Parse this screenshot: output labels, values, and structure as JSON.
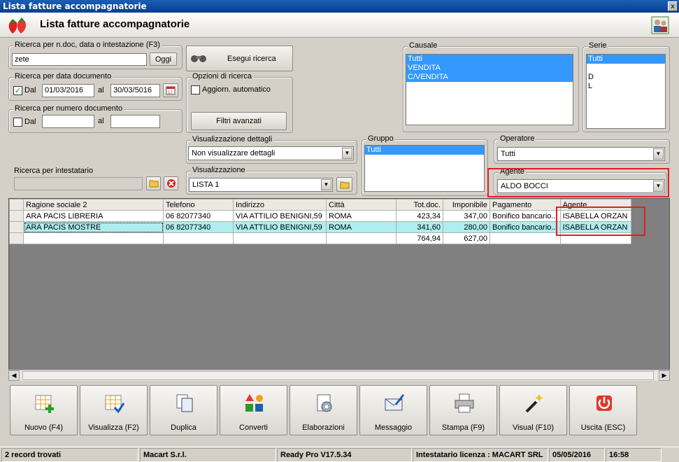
{
  "window": {
    "title": "Lista fatture accompagnatorie",
    "close_glyph": "x"
  },
  "header": {
    "title": "Lista fatture accompagnatorie"
  },
  "search_main": {
    "legend": "Ricerca per n.doc, data o intestazione (F3)",
    "value": "zete",
    "today_button": "Oggi"
  },
  "search_date": {
    "legend": "Ricerca per data documento",
    "checked": true,
    "dal_label": "Dal",
    "from": "01/03/2016",
    "al_label": "al",
    "to": "30/03/5016"
  },
  "search_number": {
    "legend": "Ricerca per numero documento",
    "checked": false,
    "dal_label": "Dal",
    "al_label": "al"
  },
  "search_holder": {
    "legend": "Ricerca per intestatario"
  },
  "run_search": {
    "label": "Esegui ricerca"
  },
  "options": {
    "legend": "Opzioni di ricerca",
    "auto_update_label": "Aggiorn. automatico",
    "auto_update": false,
    "advanced_filters": "Filtri avanzati"
  },
  "details": {
    "legend": "Visualizzazione dettagli",
    "value": "Non visualizzare dettagli"
  },
  "view": {
    "legend": "Visualizzazione",
    "value": "LISTA 1"
  },
  "causale": {
    "legend": "Causale",
    "items": [
      "Tutti",
      "VENDITA",
      "C/VENDITA"
    ],
    "selected": [
      0,
      1,
      2
    ]
  },
  "serie": {
    "legend": "Serie",
    "items": [
      "Tutti",
      "",
      "D",
      "L"
    ],
    "selected": [
      0
    ]
  },
  "gruppo": {
    "legend": "Gruppo",
    "items": [
      "Tutti"
    ],
    "selected": [
      0
    ]
  },
  "operatore": {
    "legend": "Operatore",
    "value": "Tutti"
  },
  "agente": {
    "legend": "Agente",
    "value": "ALDO BOCCI"
  },
  "table": {
    "columns": [
      "Ragione sociale 2",
      "Telefono",
      "Indirizzo",
      "Città",
      "Tot.doc.",
      "Imponibile",
      "Pagamento",
      "Agente"
    ],
    "rows": [
      [
        "ARA PACIS LIBRERIA",
        "06 82077340",
        "VIA ATTILIO BENIGNI,59",
        "ROMA",
        "423,34",
        "347,00",
        "Bonifico bancario...",
        "ISABELLA ORZAN"
      ],
      [
        "ARA PACIS MOSTRE",
        "06 82077340",
        "VIA ATTILIO BENIGNI,59",
        "ROMA",
        "341,60",
        "280,00",
        "Bonifico bancario...",
        "ISABELLA ORZAN"
      ]
    ],
    "totals": {
      "tot_doc": "764,94",
      "imponibile": "627,00"
    }
  },
  "toolbar": [
    {
      "label": "Nuovo (F4)",
      "icon": "new-grid-icon"
    },
    {
      "label": "Visualizza (F2)",
      "icon": "view-grid-icon"
    },
    {
      "label": "Duplica",
      "icon": "duplicate-icon"
    },
    {
      "label": "Converti",
      "icon": "convert-icon"
    },
    {
      "label": "Elaborazioni",
      "icon": "processing-icon"
    },
    {
      "label": "Messaggio",
      "icon": "message-icon"
    },
    {
      "label": "Stampa (F9)",
      "icon": "printer-icon"
    },
    {
      "label": "Visual (F10)",
      "icon": "magic-wand-icon"
    },
    {
      "label": "Uscita (ESC)",
      "icon": "exit-icon"
    }
  ],
  "status": {
    "records": "2 record trovati",
    "company": "Macart S.r.l.",
    "version": "Ready Pro V17.5.34",
    "license": "Intestatario licenza : MACART SRL",
    "date": "05/05/2016",
    "time": "16:58"
  },
  "colors": {
    "title_bar": "#0a3d91",
    "selection": "#3399ff",
    "highlight_row": "#aeeef0",
    "annotation": "#e02020"
  }
}
